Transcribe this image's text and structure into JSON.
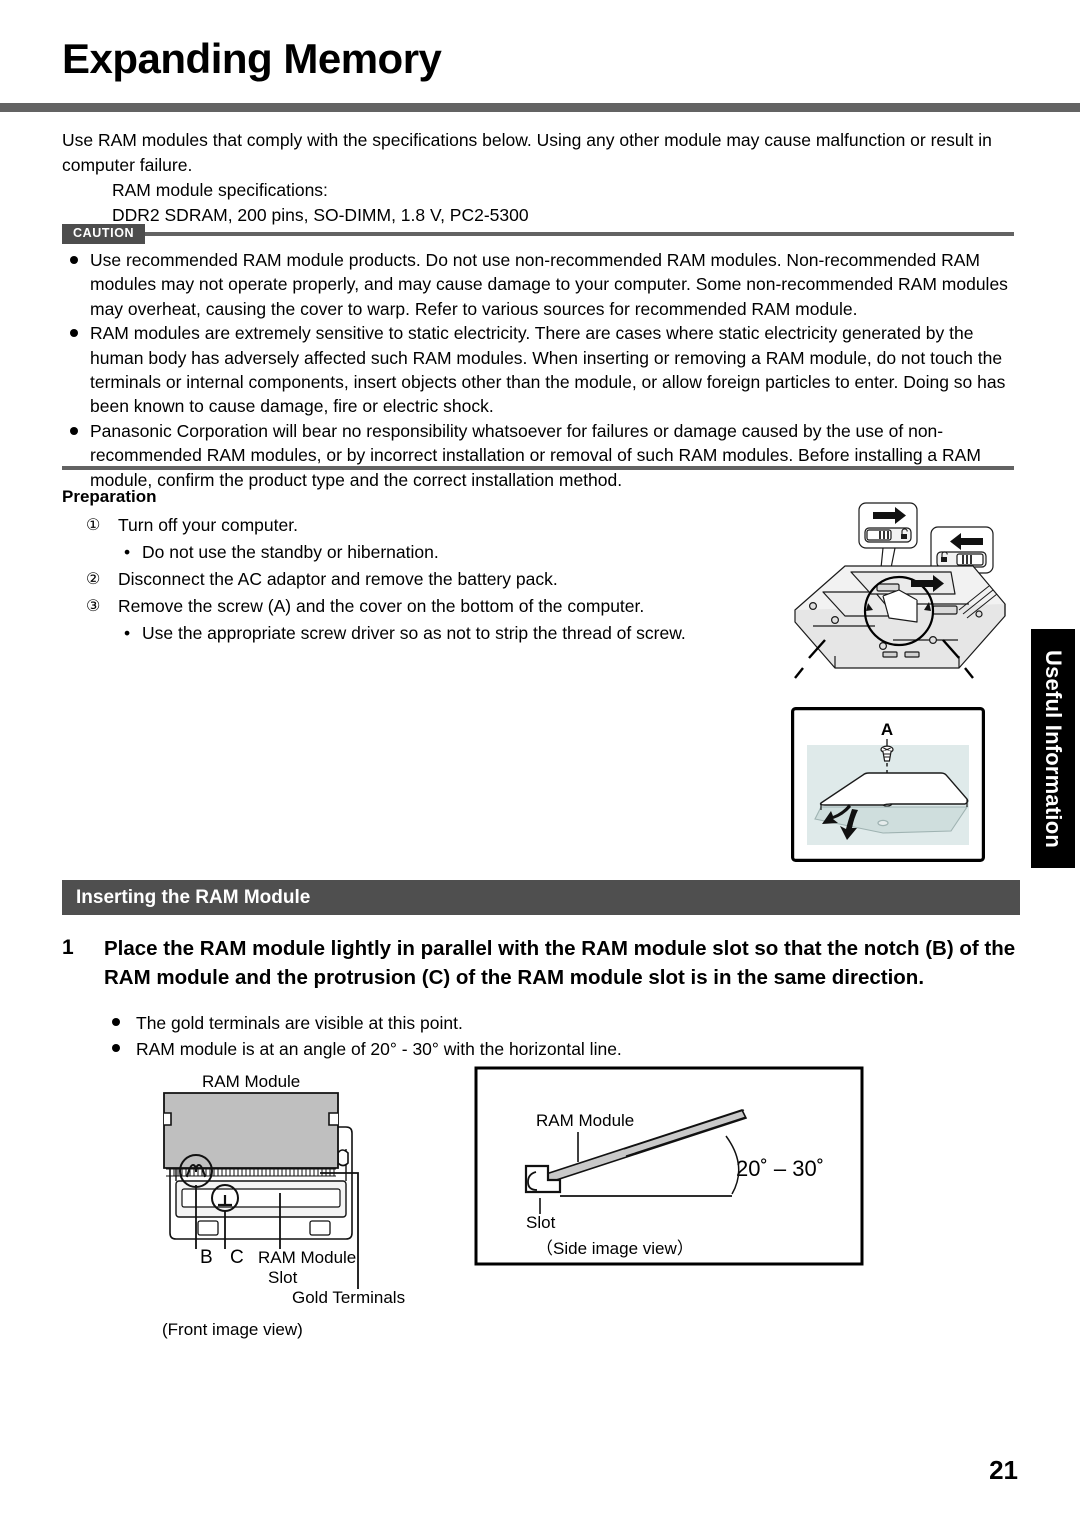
{
  "document": {
    "title": "Expanding Memory",
    "page_number": "21",
    "side_tab": "Useful Information"
  },
  "intro": {
    "paragraph": "Use RAM modules that comply with the specifications below. Using any other module may cause malfunction or result in computer failure.",
    "spec_label": "RAM module specifications:",
    "spec_value": "DDR2 SDRAM, 200 pins, SO-DIMM, 1.8 V, PC2-5300"
  },
  "caution": {
    "badge": "CAUTION",
    "bullets": [
      "Use recommended RAM module products. Do not use non-recommended RAM modules. Non-recommended RAM modules may not operate properly, and may cause damage to your computer. Some non-recommended RAM modules may overheat, causing the cover to warp. Refer to various sources for recommended RAM module.",
      "RAM modules are extremely sensitive to static electricity. There are cases where static electricity generated by the human body has adversely affected such RAM modules. When inserting or removing a RAM module, do not touch the terminals or internal components, insert objects other than the module, or allow foreign particles to enter. Doing so has been known to cause damage, fire or electric shock.",
      "Panasonic Corporation will bear no responsibility whatsoever for failures or damage caused by the use of non-recommended RAM modules, or by incorrect installation or removal of such RAM modules.  Before installing a RAM module, confirm the product type and the correct installation method."
    ]
  },
  "preparation": {
    "heading": "Preparation",
    "steps": [
      {
        "marker": "①",
        "text": "Turn off your computer."
      },
      {
        "marker": "•",
        "text": "Do not use the standby or hibernation.",
        "sub": true
      },
      {
        "marker": "②",
        "text": "Disconnect the AC adaptor and remove the battery pack."
      },
      {
        "marker": "③",
        "text": "Remove the screw (A) and the cover on the bottom of the computer."
      },
      {
        "marker": "•",
        "text": "Use the appropriate screw driver so as not to strip the thread of screw.",
        "sub": true
      }
    ]
  },
  "laptop_illustration": {
    "screw_label": "A"
  },
  "section": {
    "header": "Inserting the RAM Module",
    "step_number": "1",
    "step_text": "Place the RAM module lightly in parallel with the RAM module slot so that the notch (B) of the RAM module and the protrusion (C) of the RAM module slot is in the same direction.",
    "bullets": [
      "The gold terminals are visible at this point.",
      "RAM module is at an angle of 20° - 30° with the horizontal line."
    ]
  },
  "diagram_front": {
    "label_module_top": "RAM Module",
    "label_b": "B",
    "label_c": "C",
    "label_slot_line1": "RAM Module",
    "label_slot_line2": "Slot",
    "label_gold": "Gold Terminals",
    "caption": "(Front image view)"
  },
  "diagram_side": {
    "label_module": "RAM Module",
    "label_slot": "Slot",
    "label_angle": "20˚ – 30˚",
    "caption": "（Side image view）"
  },
  "colors": {
    "rule_gray": "#636363",
    "badge_gray": "#4d4d4d",
    "section_bar": "#4f4f4f",
    "tab_black": "#000000",
    "module_fill": "#bfbfbf",
    "panel_tint": "#dfeaea"
  }
}
